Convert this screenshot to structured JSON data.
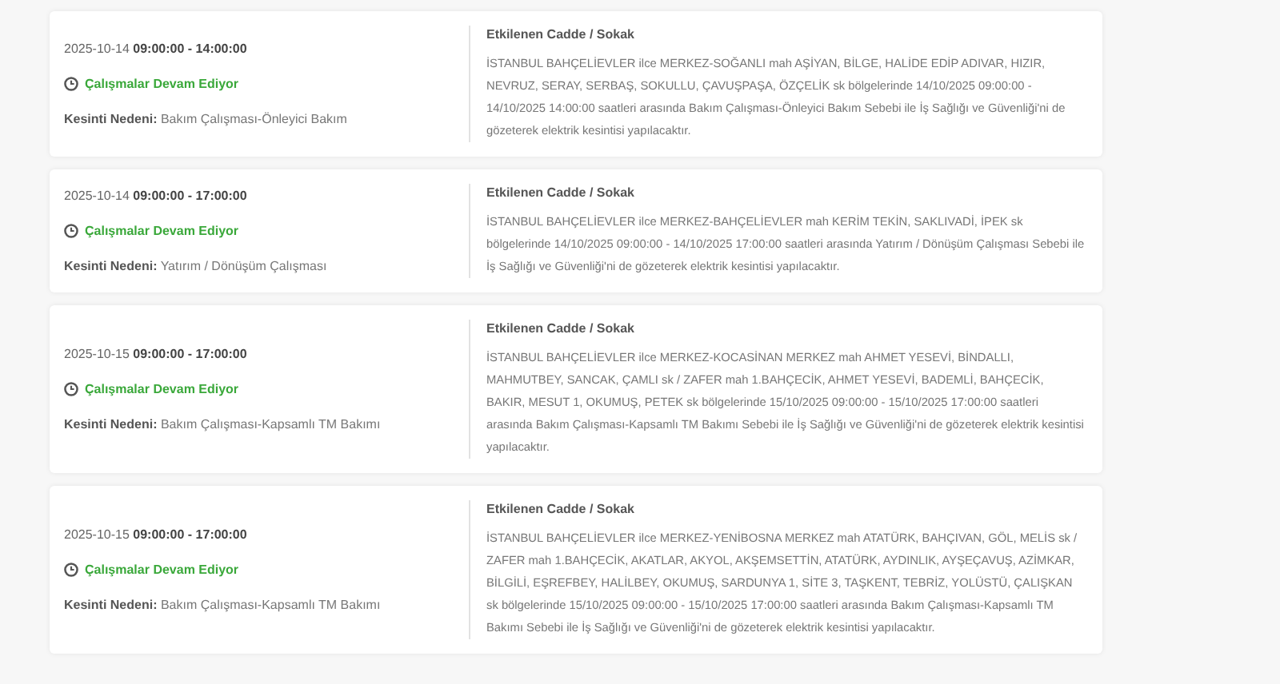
{
  "outages": [
    {
      "date": "2025-10-14",
      "time": "09:00:00 - 14:00:00",
      "status": "Çalışmalar Devam Ediyor",
      "reason_label": "Kesinti Nedeni:",
      "reason": "Bakım Çalışması-Önleyici Bakım",
      "streets_heading": "Etkilenen Cadde / Sokak",
      "description": "İSTANBUL BAHÇELİEVLER ilce MERKEZ-SOĞANLI mah AŞİYAN, BİLGE, HALİDE EDİP ADIVAR, HIZIR, NEVRUZ, SERAY, SERBAŞ, SOKULLU, ÇAVUŞPAŞA, ÖZÇELİK sk bölgelerinde 14/10/2025 09:00:00 - 14/10/2025 14:00:00 saatleri arasında Bakım Çalışması-Önleyici Bakım Sebebi ile İş Sağlığı ve Güvenliği'ni de gözeterek elektrik kesintisi yapılacaktır."
    },
    {
      "date": "2025-10-14",
      "time": "09:00:00 - 17:00:00",
      "status": "Çalışmalar Devam Ediyor",
      "reason_label": "Kesinti Nedeni:",
      "reason": "Yatırım / Dönüşüm Çalışması",
      "streets_heading": "Etkilenen Cadde / Sokak",
      "description": "İSTANBUL BAHÇELİEVLER ilce MERKEZ-BAHÇELİEVLER mah KERİM TEKİN, SAKLIVADİ, İPEK sk bölgelerinde 14/10/2025 09:00:00 - 14/10/2025 17:00:00 saatleri arasında Yatırım / Dönüşüm Çalışması Sebebi ile İş Sağlığı ve Güvenliği'ni de gözeterek elektrik kesintisi yapılacaktır."
    },
    {
      "date": "2025-10-15",
      "time": "09:00:00 - 17:00:00",
      "status": "Çalışmalar Devam Ediyor",
      "reason_label": "Kesinti Nedeni:",
      "reason": "Bakım Çalışması-Kapsamlı TM Bakımı",
      "streets_heading": "Etkilenen Cadde / Sokak",
      "description": "İSTANBUL BAHÇELİEVLER ilce MERKEZ-KOCASİNAN MERKEZ mah AHMET YESEVİ, BİNDALLI, MAHMUTBEY, SANCAK, ÇAMLI sk / ZAFER mah 1.BAHÇECİK, AHMET YESEVİ, BADEMLİ, BAHÇECİK, BAKIR, MESUT 1, OKUMUŞ, PETEK sk bölgelerinde 15/10/2025 09:00:00 - 15/10/2025 17:00:00 saatleri arasında Bakım Çalışması-Kapsamlı TM Bakımı Sebebi ile İş Sağlığı ve Güvenliği'ni de gözeterek elektrik kesintisi yapılacaktır."
    },
    {
      "date": "2025-10-15",
      "time": "09:00:00 - 17:00:00",
      "status": "Çalışmalar Devam Ediyor",
      "reason_label": "Kesinti Nedeni:",
      "reason": "Bakım Çalışması-Kapsamlı TM Bakımı",
      "streets_heading": "Etkilenen Cadde / Sokak",
      "description": "İSTANBUL BAHÇELİEVLER ilce MERKEZ-YENİBOSNA MERKEZ mah ATATÜRK, BAHÇIVAN, GÖL, MELİS sk / ZAFER mah 1.BAHÇECİK, AKATLAR, AKYOL, AKŞEMSETTİN, ATATÜRK, AYDINLIK, AYŞEÇAVUŞ, AZİMKAR, BİLGİLİ, EŞREFBEY, HALİLBEY, OKUMUŞ, SARDUNYA 1, SİTE 3, TAŞKENT, TEBRİZ, YOLÜSTÜ, ÇALIŞKAN sk bölgelerinde 15/10/2025 09:00:00 - 15/10/2025 17:00:00 saatleri arasında Bakım Çalışması-Kapsamlı TM Bakımı Sebebi ile İş Sağlığı ve Güvenliği'ni de gözeterek elektrik kesintisi yapılacaktır."
    }
  ]
}
